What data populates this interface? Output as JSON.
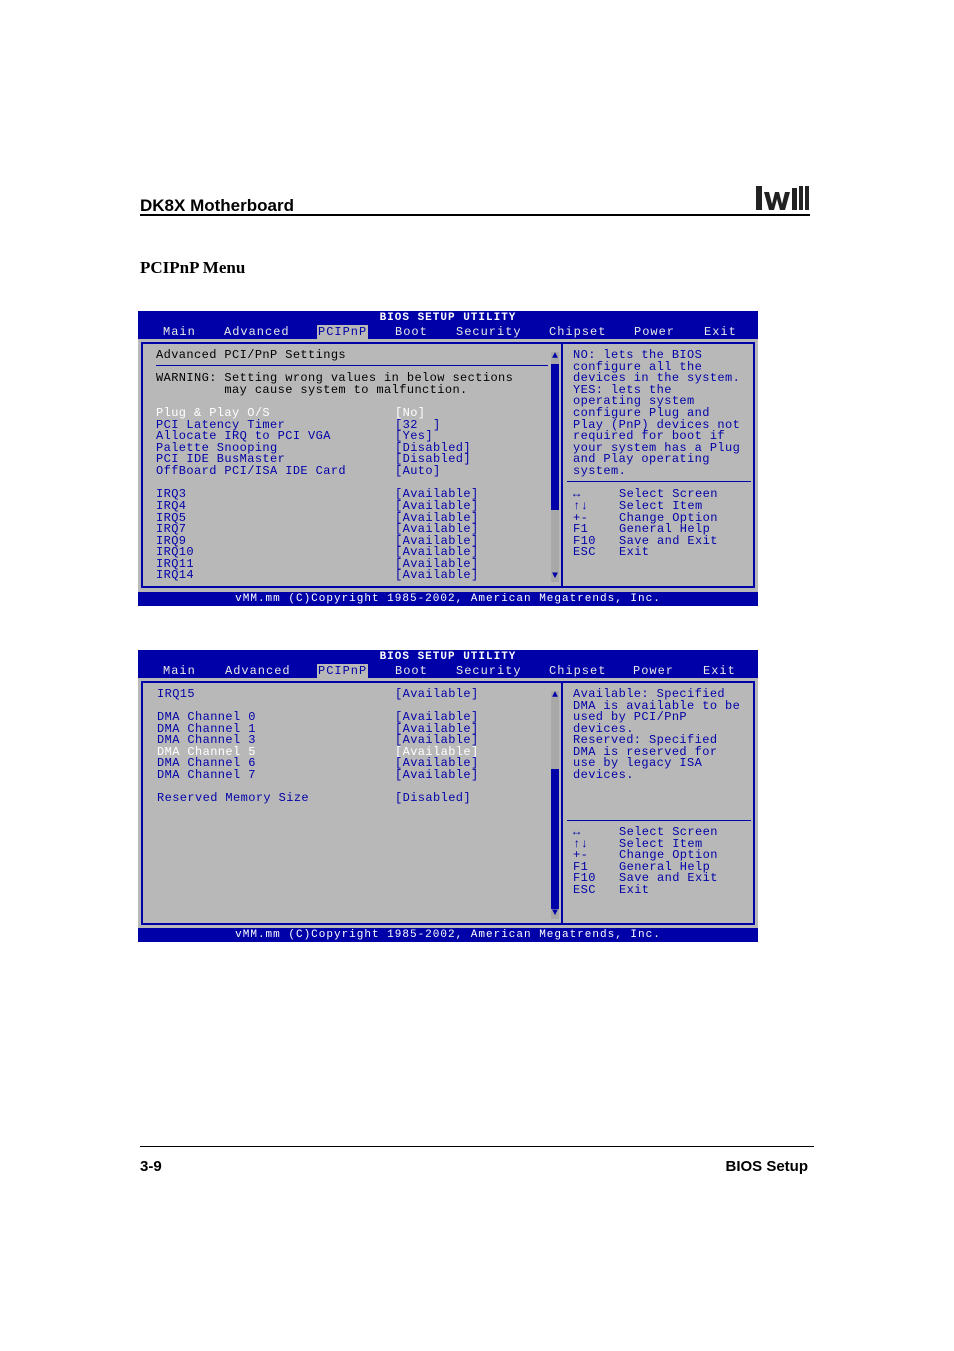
{
  "header": {
    "title": "DK8X Motherboard",
    "logo_text": "Iwill"
  },
  "section_title": "PCIPnP Menu",
  "screen1": {
    "utility_title": "BIOS SETUP UTILITY",
    "menu": [
      "Main",
      "Advanced",
      "PCIPnP",
      "Boot",
      "Security",
      "Chipset",
      "Power",
      "Exit"
    ],
    "active_menu": "PCIPnP",
    "heading": "Advanced PCI/PnP Settings",
    "warning_line1": "WARNING: Setting wrong values in below sections",
    "warning_line2": "         may cause system to malfunction.",
    "settings": [
      {
        "label": "Plug & Play O/S",
        "value": "[No]",
        "selected": true
      },
      {
        "label": "PCI Latency Timer",
        "value": "[32  ]"
      },
      {
        "label": "Allocate IRQ to PCI VGA",
        "value": "[Yes]"
      },
      {
        "label": "Palette Snooping",
        "value": "[Disabled]"
      },
      {
        "label": "PCI IDE BusMaster",
        "value": "[Disabled]"
      },
      {
        "label": "OffBoard PCI/ISA IDE Card",
        "value": "[Auto]"
      }
    ],
    "irqs": [
      {
        "label": "IRQ3",
        "value": "[Available]"
      },
      {
        "label": "IRQ4",
        "value": "[Available]"
      },
      {
        "label": "IRQ5",
        "value": "[Available]"
      },
      {
        "label": "IRQ7",
        "value": "[Available]"
      },
      {
        "label": "IRQ9",
        "value": "[Available]"
      },
      {
        "label": "IRQ10",
        "value": "[Available]"
      },
      {
        "label": "IRQ11",
        "value": "[Available]"
      },
      {
        "label": "IRQ14",
        "value": "[Available]"
      }
    ],
    "help": [
      "NO: lets the BIOS",
      "configure all the",
      "devices in the system.",
      "YES: lets the",
      "operating system",
      "configure Plug and",
      "Play (PnP) devices not",
      "required for boot if",
      "your system has a Plug",
      "and Play operating",
      "system."
    ],
    "keys": [
      {
        "key": "↔",
        "desc": "Select Screen"
      },
      {
        "key": "↑↓",
        "desc": "Select Item"
      },
      {
        "key": "+-",
        "desc": "Change Option"
      },
      {
        "key": "F1",
        "desc": "General Help"
      },
      {
        "key": "F10",
        "desc": "Save and Exit"
      },
      {
        "key": "ESC",
        "desc": "Exit"
      }
    ],
    "footer": "vMM.mm (C)Copyright 1985-2002, American Megatrends, Inc."
  },
  "screen2": {
    "utility_title": "BIOS SETUP UTILITY",
    "menu": [
      "Main",
      "Advanced",
      "PCIPnP",
      "Boot",
      "Security",
      "Chipset",
      "Power",
      "Exit"
    ],
    "active_menu": "PCIPnP",
    "items": [
      {
        "label": "IRQ15",
        "value": "[Available]"
      },
      {
        "label": "DMA Channel 0",
        "value": "[Available]"
      },
      {
        "label": "DMA Channel 1",
        "value": "[Available]"
      },
      {
        "label": "DMA Channel 3",
        "value": "[Available]"
      },
      {
        "label": "DMA Channel 5",
        "value": "[Available]",
        "selected": true
      },
      {
        "label": "DMA Channel 6",
        "value": "[Available]"
      },
      {
        "label": "DMA Channel 7",
        "value": "[Available]"
      },
      {
        "label": "Reserved Memory Size",
        "value": "[Disabled]"
      }
    ],
    "help": [
      "Available: Specified",
      "DMA is available to be",
      "used by PCI/PnP",
      "devices.",
      "Reserved: Specified",
      "DMA is reserved for",
      "use by legacy ISA",
      "devices."
    ],
    "keys": [
      {
        "key": "↔",
        "desc": "Select Screen"
      },
      {
        "key": "↑↓",
        "desc": "Select Item"
      },
      {
        "key": "+-",
        "desc": "Change Option"
      },
      {
        "key": "F1",
        "desc": "General Help"
      },
      {
        "key": "F10",
        "desc": "Save and Exit"
      },
      {
        "key": "ESC",
        "desc": "Exit"
      }
    ],
    "footer": "vMM.mm (C)Copyright 1985-2002, American Megatrends, Inc."
  },
  "page_footer": {
    "page_number": "3-9",
    "section": "BIOS Setup"
  }
}
